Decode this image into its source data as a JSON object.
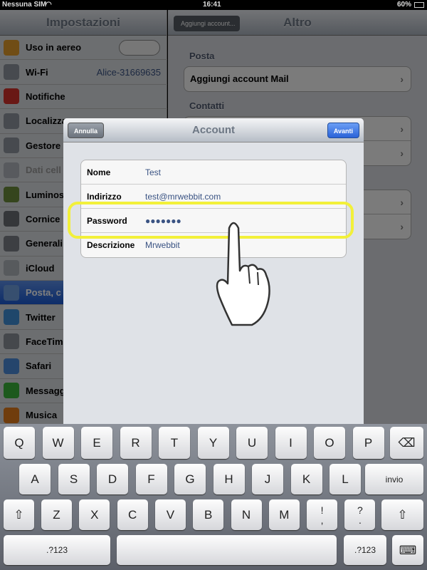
{
  "status": {
    "carrier": "Nessuna SIM",
    "time": "16:41",
    "battery": "60%"
  },
  "sidebar": {
    "title": "Impostazioni",
    "items": [
      {
        "label": "Uso in aereo",
        "icon": "airplane-icon",
        "color": "#e09a2a"
      },
      {
        "label": "Wi-Fi",
        "value": "Alice-31669635",
        "icon": "wifi-icon",
        "color": "#8e959e"
      },
      {
        "label": "Notifiche",
        "icon": "notifications-icon",
        "color": "#d2302a"
      },
      {
        "label": "Localizza",
        "icon": "location-icon",
        "color": "#8e959e"
      },
      {
        "label": "Gestore",
        "icon": "phone-icon",
        "color": "#8e959e"
      },
      {
        "label": "Dati cell",
        "icon": "cellular-icon",
        "color": "#b0b5bc",
        "dim": true
      },
      {
        "label": "Luminos",
        "icon": "brightness-icon",
        "color": "#6a8a3a"
      },
      {
        "label": "Cornice",
        "icon": "picture-frame-icon",
        "color": "#6a6e74"
      },
      {
        "label": "Generali",
        "icon": "gear-icon",
        "color": "#7a7f86"
      },
      {
        "label": "iCloud",
        "icon": "icloud-icon",
        "color": "#aeb4bb"
      },
      {
        "label": "Posta, c",
        "icon": "mail-icon",
        "color": "#6e9ede",
        "selected": true
      },
      {
        "label": "Twitter",
        "icon": "twitter-icon",
        "color": "#3f8fd6"
      },
      {
        "label": "FaceTim",
        "icon": "facetime-icon",
        "color": "#8a9098"
      },
      {
        "label": "Safari",
        "icon": "safari-icon",
        "color": "#4a8ad8"
      },
      {
        "label": "Messagg",
        "icon": "messages-icon",
        "color": "#3ab33a"
      },
      {
        "label": "Musica",
        "icon": "music-icon",
        "color": "#e07a1a"
      }
    ]
  },
  "right": {
    "back": "Aggiungi account...",
    "title": "Altro",
    "section1": "Posta",
    "add_mail": "Aggiungi account Mail",
    "section2": "Contatti"
  },
  "modal": {
    "cancel": "Annulla",
    "title": "Account",
    "next": "Avanti",
    "fields": [
      {
        "label": "Nome",
        "value": "Test"
      },
      {
        "label": "Indirizzo",
        "value": "test@mrwebbit.com"
      },
      {
        "label": "Password",
        "value": "●●●●●●●"
      },
      {
        "label": "Descrizione",
        "value": "Mrwebbit"
      }
    ]
  },
  "keyboard": {
    "row1": [
      "Q",
      "W",
      "E",
      "R",
      "T",
      "Y",
      "U",
      "I",
      "O",
      "P"
    ],
    "row2": [
      "A",
      "S",
      "D",
      "F",
      "G",
      "H",
      "J",
      "K",
      "L"
    ],
    "row3": [
      "Z",
      "X",
      "C",
      "V",
      "B",
      "N",
      "M",
      "!\n,",
      "?\n."
    ],
    "return": "invio",
    "numbers": ".?123",
    "icons": {
      "backspace": "⌫",
      "shift": "⇧",
      "hide": "⌨"
    }
  },
  "colors": {
    "accent": "#2f6fe0",
    "highlight": "#f2f03a"
  }
}
